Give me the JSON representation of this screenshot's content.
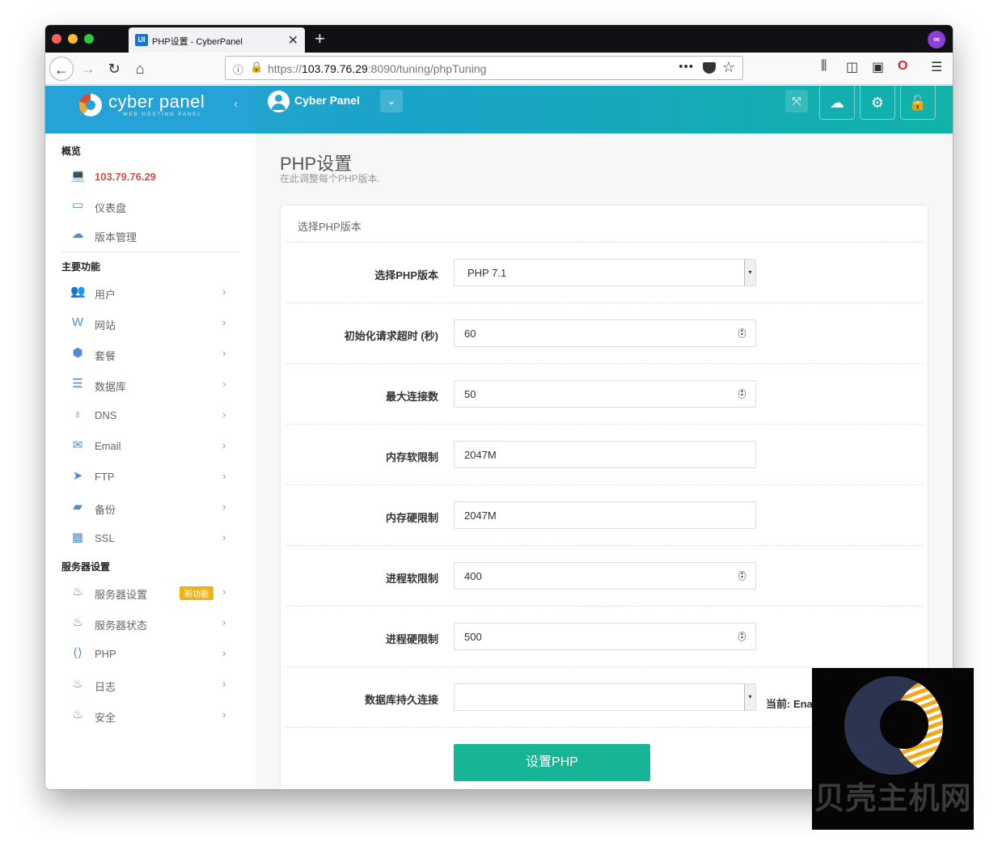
{
  "browser": {
    "tab_title": "PHP设置 - CyberPanel",
    "tab_favicon": "UI",
    "url_prefix": "https://",
    "url_host": "103.79.76.29",
    "url_rest": ":8090/tuning/phpTuning",
    "icons": [
      "back-icon",
      "forward-icon",
      "reload-icon",
      "home-icon",
      "info-icon",
      "lock-icon",
      "more-icon",
      "pocket-icon",
      "star-icon",
      "library-icon",
      "sidebar-icon",
      "container-icon",
      "opera-icon",
      "menu-icon",
      "private-mask-icon"
    ]
  },
  "header": {
    "logo_text": "cyber panel",
    "logo_sub": "WEB HOSTING PANEL",
    "user_name": "Cyber Panel"
  },
  "sidebar": {
    "overview_title": "概览",
    "overview_items": [
      {
        "label": "103.79.76.29",
        "icon": "laptop-icon"
      },
      {
        "label": "仪表盘",
        "icon": "dashboard-icon"
      },
      {
        "label": "版本管理",
        "icon": "cloud-upload-icon"
      }
    ],
    "main_title": "主要功能",
    "main_items": [
      {
        "label": "用户",
        "icon": "users-icon"
      },
      {
        "label": "网站",
        "icon": "website-icon"
      },
      {
        "label": "套餐",
        "icon": "packages-icon"
      },
      {
        "label": "数据库",
        "icon": "database-icon"
      },
      {
        "label": "DNS",
        "icon": "bulb-icon"
      },
      {
        "label": "Email",
        "icon": "envelope-icon"
      },
      {
        "label": "FTP",
        "icon": "paper-plane-icon"
      },
      {
        "label": "备份",
        "icon": "folder-icon"
      },
      {
        "label": "SSL",
        "icon": "briefcase-icon"
      }
    ],
    "server_title": "服务器设置",
    "server_items": [
      {
        "label": "服务器设置",
        "icon": "flame-icon",
        "badge": "新功能"
      },
      {
        "label": "服务器状态",
        "icon": "flame-icon"
      },
      {
        "label": "PHP",
        "icon": "code-file-icon"
      },
      {
        "label": "日志",
        "icon": "flame-icon"
      },
      {
        "label": "安全",
        "icon": "flame-icon"
      }
    ]
  },
  "page": {
    "title": "PHP设置",
    "subtitle": "在此调整每个PHP版本.",
    "panel_title": "选择PHP版本",
    "rows": [
      {
        "label": "选择PHP版本",
        "value": "PHP 7.1",
        "type": "select"
      },
      {
        "label": "初始化请求超时 (秒)",
        "value": "60",
        "type": "number"
      },
      {
        "label": "最大连接数",
        "value": "50",
        "type": "number"
      },
      {
        "label": "内存软限制",
        "value": "2047M",
        "type": "text"
      },
      {
        "label": "内存硬限制",
        "value": "2047M",
        "type": "text"
      },
      {
        "label": "进程软限制",
        "value": "400",
        "type": "number"
      },
      {
        "label": "进程硬限制",
        "value": "500",
        "type": "number"
      },
      {
        "label": "数据库持久连接",
        "value": "",
        "type": "select"
      }
    ],
    "current_note": "当前: Enabled",
    "submit_label": "设置PHP"
  },
  "watermark": {
    "text": "贝壳主机网"
  }
}
